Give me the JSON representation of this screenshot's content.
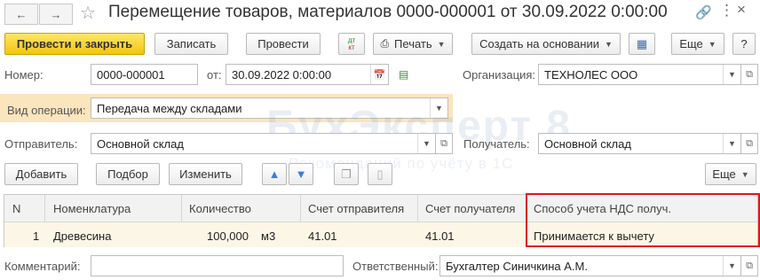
{
  "window": {
    "title": "Перемещение товаров, материалов 0000-000001 от 30.09.2022 0:00:00"
  },
  "toolbar": {
    "post_close": "Провести и закрыть",
    "save": "Записать",
    "post": "Провести",
    "dt_kt": "дт кт",
    "print": "Печать",
    "create_based": "Создать на основании",
    "more": "Еще"
  },
  "form": {
    "number_label": "Номер:",
    "number_value": "0000-000001",
    "date_label": "от:",
    "date_value": "30.09.2022  0:00:00",
    "org_label": "Организация:",
    "org_value": "ТЕХНОЛЕС ООО",
    "op_label": "Вид операции:",
    "op_value": "Передача между складами",
    "sender_label": "Отправитель:",
    "sender_value": "Основной склад",
    "receiver_label": "Получатель:",
    "receiver_value": "Основной склад",
    "comment_label": "Комментарий:",
    "comment_value": "",
    "responsible_label": "Ответственный:",
    "responsible_value": "Бухгалтер Синичкина А.М."
  },
  "table_toolbar": {
    "add": "Добавить",
    "select": "Подбор",
    "change": "Изменить",
    "more": "Еще"
  },
  "table": {
    "headers": [
      "N",
      "Номенклатура",
      "Количество",
      "Счет отправителя",
      "Счет получателя",
      "Способ учета НДС получ."
    ],
    "rows": [
      {
        "n": "1",
        "item": "Древесина",
        "qty": "100,000",
        "unit": "м3",
        "acct_from": "41.01",
        "acct_to": "41.01",
        "vat": "Принимается к вычету"
      }
    ]
  },
  "watermark": {
    "brand": "БухЭксперт 8",
    "tagline": "Рекомендаций по учёту в 1С"
  },
  "colors": {
    "primary_button": "#f4c60a",
    "op_highlight": "#fbe5bd",
    "annotation_box": "#e0161b"
  }
}
